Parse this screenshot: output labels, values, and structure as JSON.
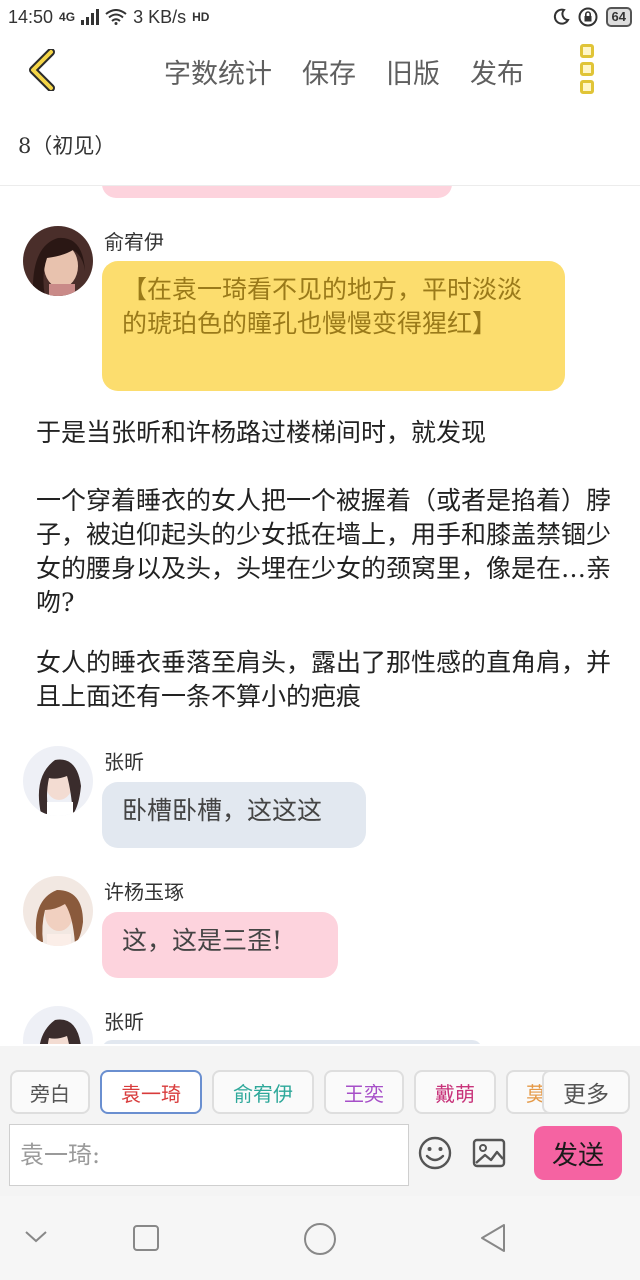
{
  "status_bar": {
    "time": "14:50",
    "network": "4G",
    "speed": "3 KB/s",
    "hd": "HD",
    "battery": "64"
  },
  "header": {
    "actions": [
      "字数统计",
      "保存",
      "旧版",
      "发布"
    ]
  },
  "chapter": {
    "title": "8（初见）"
  },
  "messages": [
    {
      "name": "俞宥伊",
      "text": "【在袁一琦看不见的地方，平时淡淡的琥珀色的瞳孔也慢慢变得猩红】",
      "color": "#fcdd6e",
      "text_color": "#9a7a1a"
    },
    {
      "name": "张昕",
      "text": "卧槽卧槽，这这这",
      "color": "#e2e8f0",
      "text_color": "#444444"
    },
    {
      "name": "许杨玉琢",
      "text": "这，这是三歪!",
      "color": "#fdd3dd",
      "text_color": "#444444"
    },
    {
      "name": "张昕"
    }
  ],
  "narration": [
    "于是当张昕和许杨路过楼梯间时，就发现",
    "一个穿着睡衣的女人把一个被握着（或者是掐着）脖子，被迫仰起头的少女抵在墙上，用手和膝盖禁锢少女的腰身以及头，头埋在少女的颈窝里，像是在…亲吻?",
    "女人的睡衣垂落至肩头，露出了那性感的直角肩，并且上面还有一条不算小的疤痕"
  ],
  "characters": {
    "chips": [
      {
        "label": "旁白",
        "color": "#555555"
      },
      {
        "label": "袁一琦",
        "color": "#d83b3b",
        "selected": true
      },
      {
        "label": "俞宥伊",
        "color": "#2ea89a"
      },
      {
        "label": "王奕",
        "color": "#a64fc8"
      },
      {
        "label": "戴萌",
        "color": "#c8337a"
      },
      {
        "label": "莫",
        "color": "#e59a48"
      }
    ],
    "more_label": "更多"
  },
  "composer": {
    "placeholder": "袁一琦:",
    "send_label": "发送"
  }
}
